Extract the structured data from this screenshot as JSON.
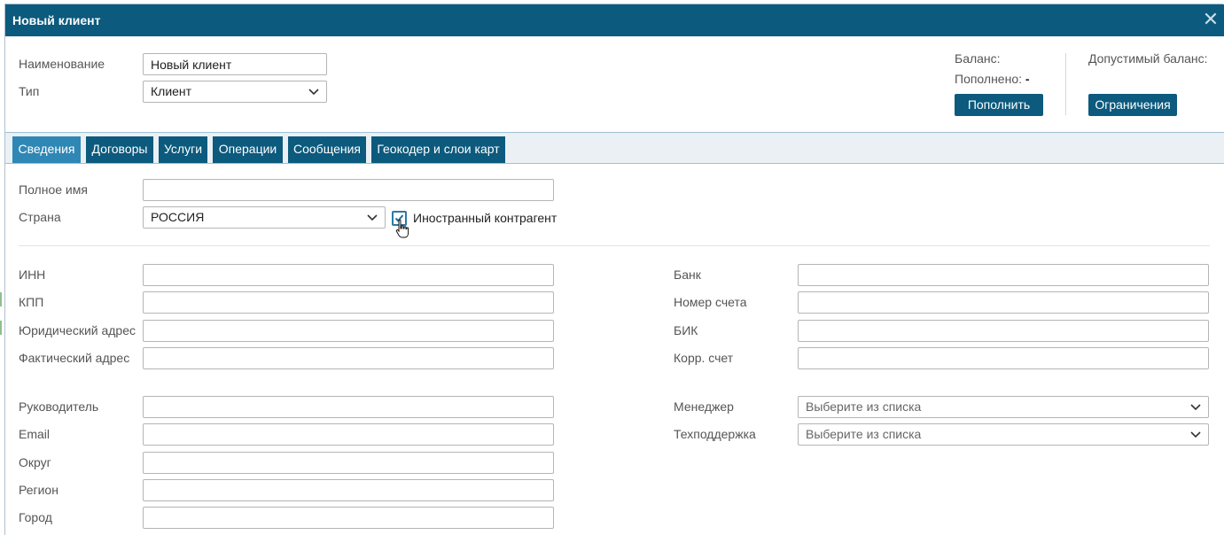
{
  "dialog": {
    "title": "Новый клиент",
    "close_icon": "close-icon"
  },
  "header": {
    "name_label": "Наименование",
    "name_value": "Новый клиент",
    "type_label": "Тип",
    "type_value": "Клиент",
    "balance_label": "Баланс:",
    "topped_label": "Пополнено:",
    "topped_value": "-",
    "allowed_balance_label": "Допустимый баланс:",
    "topup_button": "Пополнить",
    "limits_button": "Ограничения"
  },
  "tabs": [
    {
      "label": "Сведения",
      "active": true
    },
    {
      "label": "Договоры",
      "active": false
    },
    {
      "label": "Услуги",
      "active": false
    },
    {
      "label": "Операции",
      "active": false
    },
    {
      "label": "Сообщения",
      "active": false
    },
    {
      "label": "Геокодер и слои карт",
      "active": false
    }
  ],
  "info": {
    "full_name_label": "Полное имя",
    "full_name_value": "",
    "country_label": "Страна",
    "country_value": "РОССИЯ",
    "foreign_label": "Иностранный контрагент",
    "foreign_checked": true,
    "inn_label": "ИНН",
    "kpp_label": "КПП",
    "legal_address_label": "Юридический адрес",
    "actual_address_label": "Фактический адрес",
    "bank_label": "Банк",
    "account_label": "Номер счета",
    "bik_label": "БИК",
    "corr_account_label": "Корр. счет",
    "head_label": "Руководитель",
    "email_label": "Email",
    "district_label": "Округ",
    "region_label": "Регион",
    "city_label": "Город",
    "manager_label": "Менеджер",
    "manager_placeholder": "Выберите из списка",
    "support_label": "Техподдержка",
    "support_placeholder": "Выберите из списка"
  },
  "colors": {
    "primary": "#0c5a7d",
    "tab_active": "#2f87b5",
    "checkbox": "#2b79a8"
  }
}
